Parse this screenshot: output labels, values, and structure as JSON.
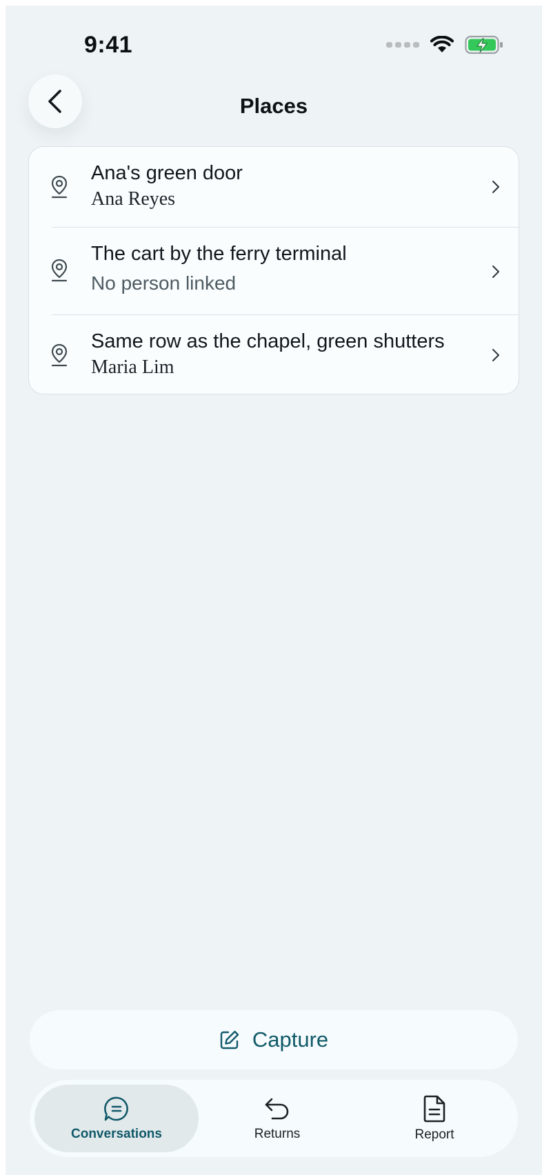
{
  "status_bar": {
    "time": "9:41"
  },
  "header": {
    "title": "Places",
    "back_icon": "chevron-left-icon"
  },
  "places": [
    {
      "title": "Ana's green door",
      "subtitle": "Ana Reyes",
      "linked": true
    },
    {
      "title": "The cart by the ferry terminal",
      "subtitle": "No person linked",
      "linked": false
    },
    {
      "title": "Same row as the chapel, green shutters",
      "subtitle": "Maria Lim",
      "linked": true
    }
  ],
  "capture": {
    "label": "Capture",
    "icon": "edit-icon"
  },
  "tabs": [
    {
      "label": "Conversations",
      "icon": "chat-bubble-icon",
      "active": true
    },
    {
      "label": "Returns",
      "icon": "return-arrow-icon",
      "active": false
    },
    {
      "label": "Report",
      "icon": "document-icon",
      "active": false
    }
  ],
  "colors": {
    "background": "#eef3f5",
    "accent": "#11596a",
    "battery_fill": "#34c759"
  }
}
